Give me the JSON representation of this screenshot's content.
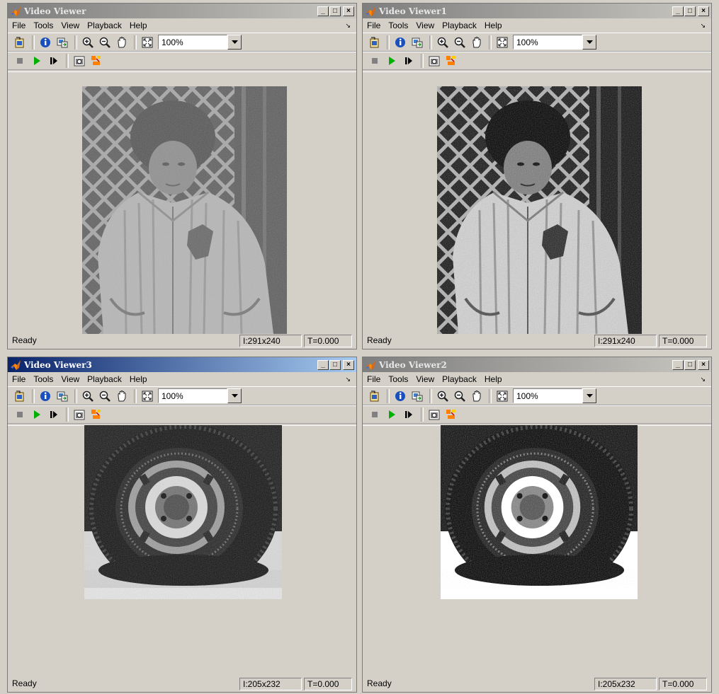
{
  "menu": [
    "File",
    "Tools",
    "View",
    "Playback",
    "Help"
  ],
  "windows": [
    {
      "title": "Video Viewer",
      "active": false,
      "zoom": "100%",
      "status": "Ready",
      "dims": "I:291x240",
      "time": "T=0.000",
      "image": "child",
      "contrast": "low"
    },
    {
      "title": "Video Viewer1",
      "active": false,
      "zoom": "100%",
      "status": "Ready",
      "dims": "I:291x240",
      "time": "T=0.000",
      "image": "child",
      "contrast": "high"
    },
    {
      "title": "Video Viewer3",
      "active": true,
      "zoom": "100%",
      "status": "Ready",
      "dims": "I:205x232",
      "time": "T=0.000",
      "image": "tire",
      "contrast": "normal"
    },
    {
      "title": "Video Viewer2",
      "active": false,
      "zoom": "100%",
      "status": "Ready",
      "dims": "I:205x232",
      "time": "T=0.000",
      "image": "tire",
      "contrast": "high"
    }
  ],
  "caption_buttons": {
    "minimize": "_",
    "maximize": "□",
    "close": "×"
  },
  "icons": {
    "app": "matlab-membrane-icon",
    "toolbar1": [
      "new-viewer-icon",
      "info-icon",
      "export-icon",
      "zoom-in-icon",
      "zoom-out-icon",
      "pan-hand-icon",
      "fit-to-window-icon"
    ],
    "toolbar2": [
      "stop-icon",
      "play-icon",
      "step-forward-icon",
      "snapshot-icon",
      "highlight-icon"
    ]
  },
  "colors": {
    "play": "#00b000",
    "stop": "#808080",
    "title_active": "#0a246a",
    "title_inactive": "#7e7e7e"
  }
}
